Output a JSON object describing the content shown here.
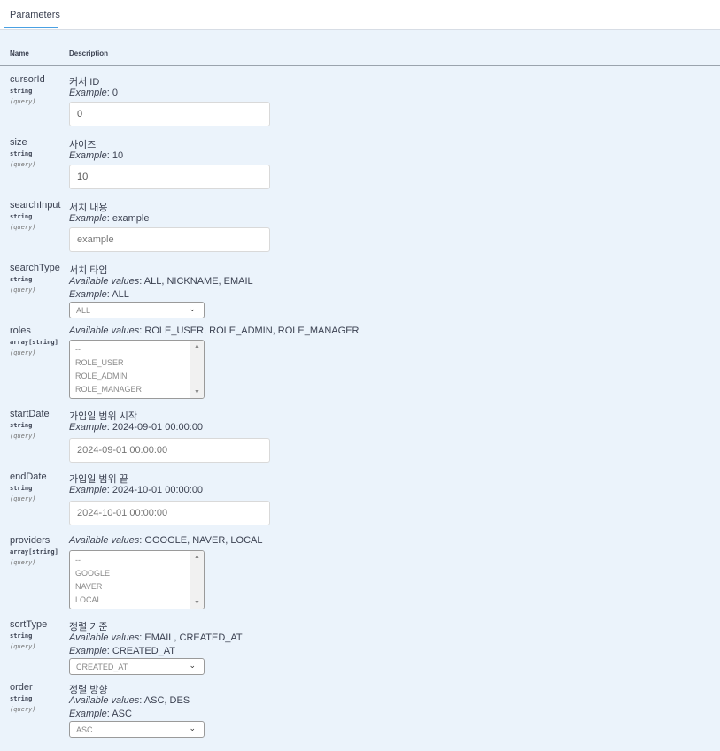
{
  "tabs": {
    "parameters": "Parameters"
  },
  "columns": {
    "name": "Name",
    "description": "Description"
  },
  "params": {
    "cursorId": {
      "name": "cursorId",
      "type": "string",
      "in": "(query)",
      "desc": "커서 ID",
      "example_label": "Example",
      "example_value": ": 0",
      "input_value": "0"
    },
    "size": {
      "name": "size",
      "type": "string",
      "in": "(query)",
      "desc": "사이즈",
      "example_label": "Example",
      "example_value": ": 10",
      "input_value": "10"
    },
    "searchInput": {
      "name": "searchInput",
      "type": "string",
      "in": "(query)",
      "desc": "서치 내용",
      "example_label": "Example",
      "example_value": ": example",
      "placeholder": "example"
    },
    "searchType": {
      "name": "searchType",
      "type": "string",
      "in": "(query)",
      "desc": "서치 타입",
      "avail_label": "Available values",
      "avail_value": ": ALL, NICKNAME, EMAIL",
      "example_label": "Example",
      "example_value": ": ALL",
      "selected": "ALL"
    },
    "roles": {
      "name": "roles",
      "type": "array[string]",
      "in": "(query)",
      "avail_label": "Available values",
      "avail_value": ": ROLE_USER, ROLE_ADMIN, ROLE_MANAGER",
      "options": [
        "--",
        "ROLE_USER",
        "ROLE_ADMIN",
        "ROLE_MANAGER"
      ]
    },
    "startDate": {
      "name": "startDate",
      "type": "string",
      "in": "(query)",
      "desc": "가입일 범위 시작",
      "example_label": "Example",
      "example_value": ": 2024-09-01 00:00:00",
      "placeholder": "2024-09-01 00:00:00"
    },
    "endDate": {
      "name": "endDate",
      "type": "string",
      "in": "(query)",
      "desc": "가입일 범위 끝",
      "example_label": "Example",
      "example_value": ": 2024-10-01 00:00:00",
      "placeholder": "2024-10-01 00:00:00"
    },
    "providers": {
      "name": "providers",
      "type": "array[string]",
      "in": "(query)",
      "avail_label": "Available values",
      "avail_value": ": GOOGLE, NAVER, LOCAL",
      "options": [
        "--",
        "GOOGLE",
        "NAVER",
        "LOCAL"
      ]
    },
    "sortType": {
      "name": "sortType",
      "type": "string",
      "in": "(query)",
      "desc": "정렬 기준",
      "avail_label": "Available values",
      "avail_value": ": EMAIL, CREATED_AT",
      "example_label": "Example",
      "example_value": ": CREATED_AT",
      "selected": "CREATED_AT"
    },
    "order": {
      "name": "order",
      "type": "string",
      "in": "(query)",
      "desc": "정렬 방향",
      "avail_label": "Available values",
      "avail_value": ": ASC, DES",
      "example_label": "Example",
      "example_value": ": ASC",
      "selected": "ASC"
    }
  },
  "icons": {
    "chevron": "chevron-down-icon",
    "scroll_up": "scroll-up-arrow-icon",
    "scroll_down": "scroll-down-arrow-icon"
  },
  "colors": {
    "tab_underline": "#49a0e3",
    "background": "#ebf3fb"
  }
}
